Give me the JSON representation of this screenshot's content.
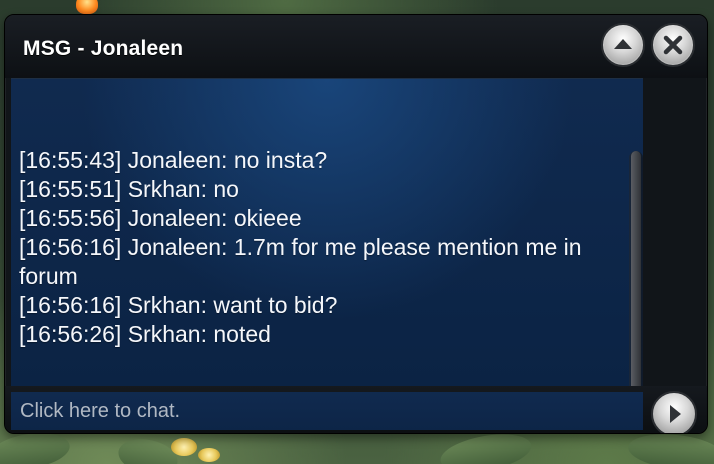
{
  "window": {
    "title": "MSG - Jonaleen"
  },
  "buttons": {
    "up_icon": "chevron-up-icon",
    "close_icon": "close-icon",
    "send_icon": "play-arrow-icon"
  },
  "messages": [
    {
      "text": "[16:55:43] Jonaleen: no insta?"
    },
    {
      "text": "[16:55:51] Srkhan: no"
    },
    {
      "text": "[16:55:56] Jonaleen: okieee"
    },
    {
      "text": "[16:56:16] Jonaleen: 1.7m for me please mention me in forum"
    },
    {
      "text": "[16:56:16] Srkhan: want to bid?"
    },
    {
      "text": "[16:56:26] Srkhan: noted"
    }
  ],
  "input": {
    "placeholder": "Click here to chat."
  },
  "colors": {
    "chat_background": "#102a4f",
    "title_bar": "#111519",
    "text": "#f5f7fb"
  }
}
